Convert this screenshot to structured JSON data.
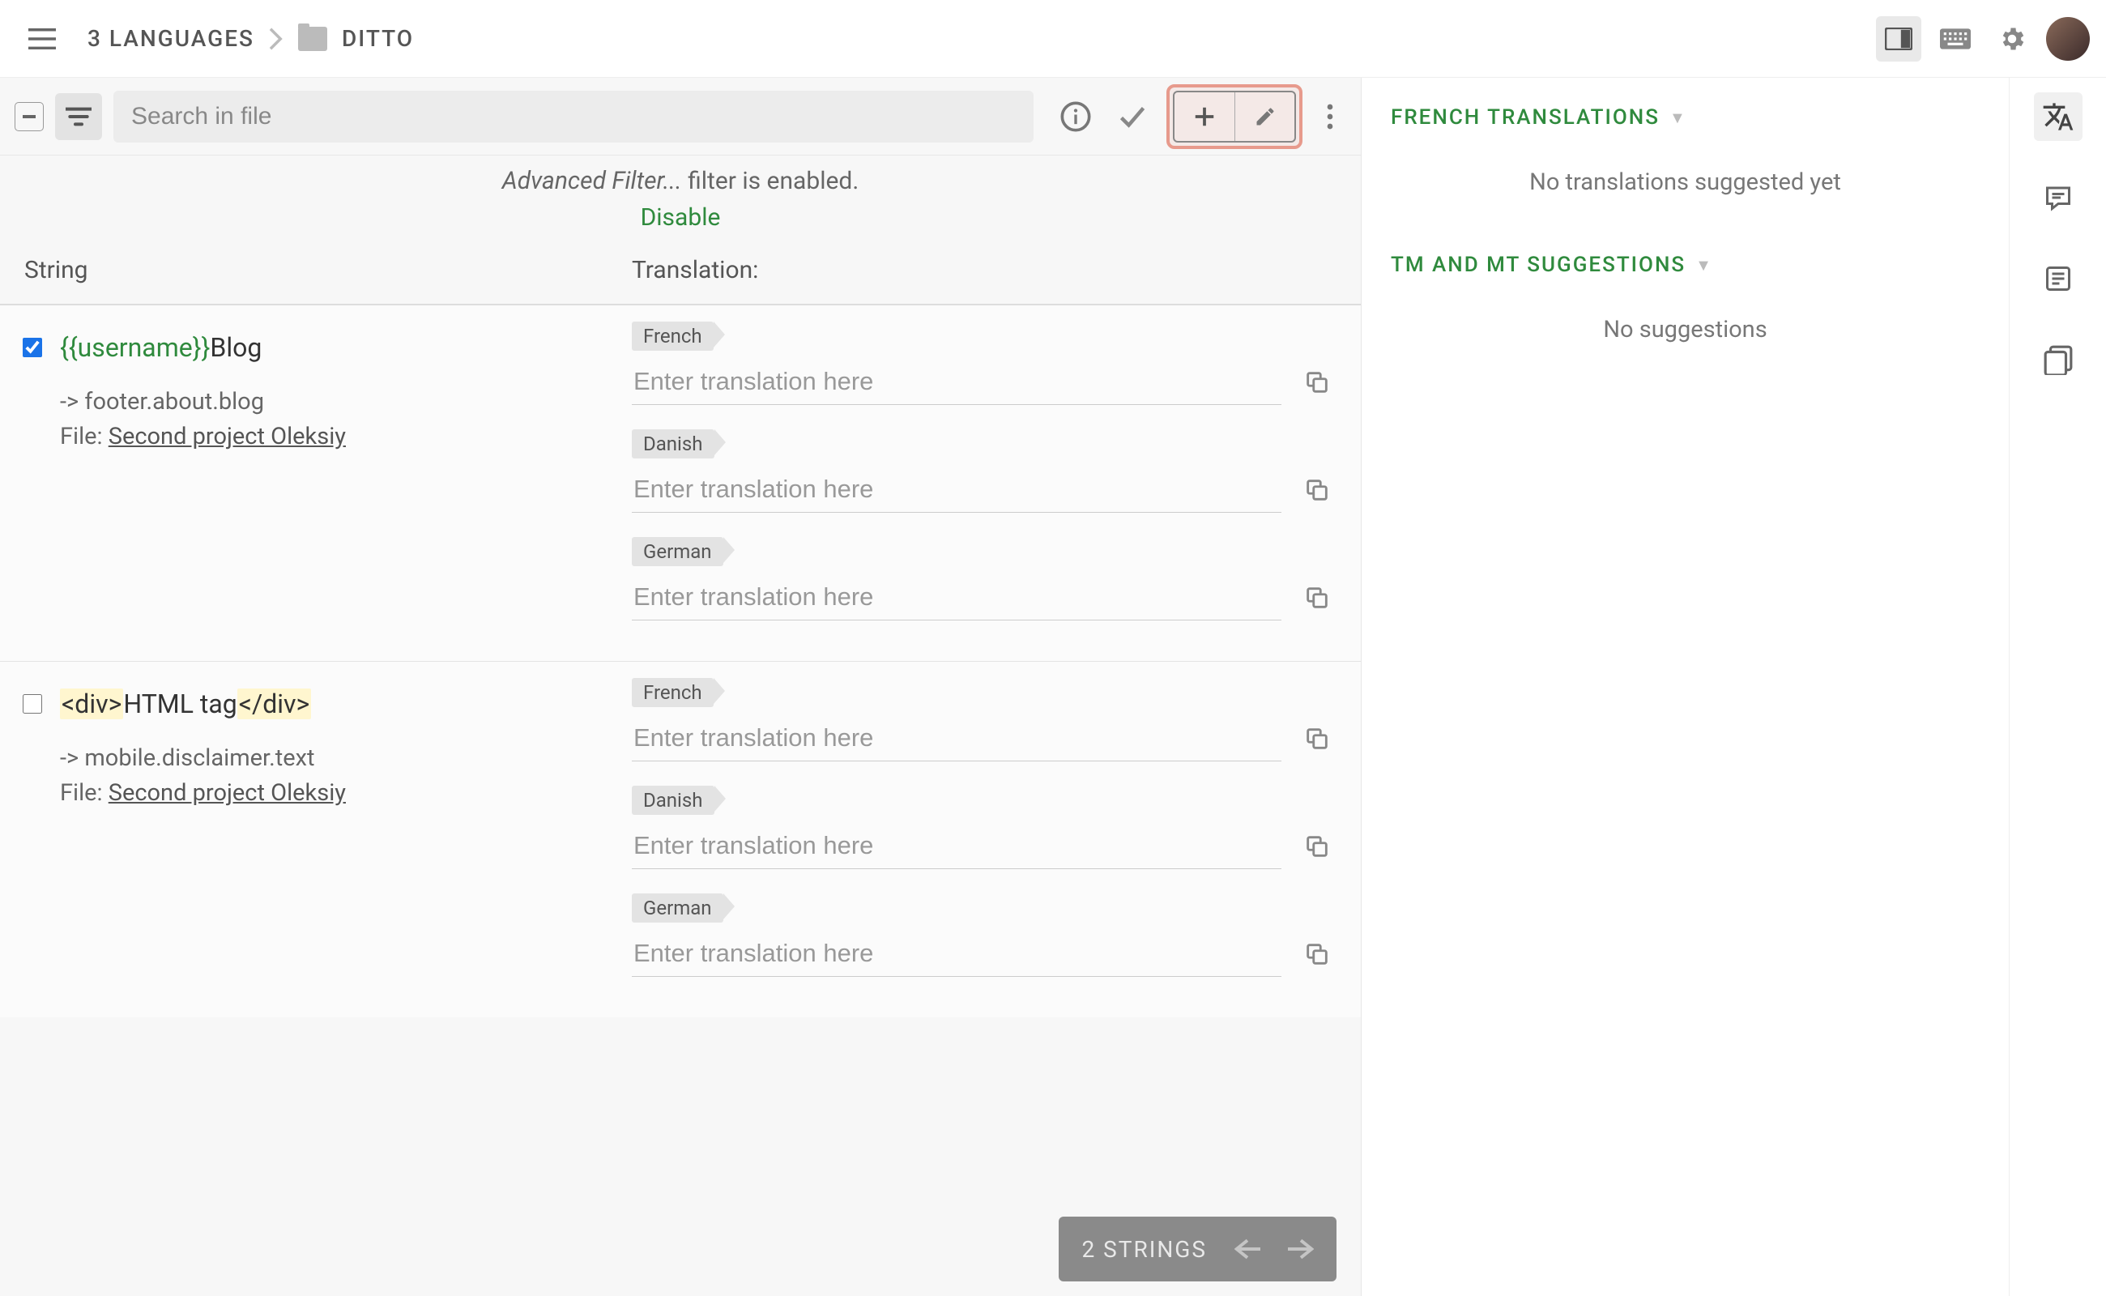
{
  "header": {
    "breadcrumb1": "3 LANGUAGES",
    "breadcrumb2": "DITTO"
  },
  "toolbar": {
    "search_placeholder": "Search in file"
  },
  "filter_notice": {
    "italic": "Advanced Filter...",
    "rest": " filter is enabled.",
    "disable": "Disable"
  },
  "columns": {
    "string": "String",
    "translation": "Translation:"
  },
  "strings": [
    {
      "checked": true,
      "token": "{{username}}",
      "rest": "Blog",
      "type": "token",
      "context": "-> footer.about.blog",
      "file_label": "File: ",
      "file_link": "Second project Oleksiy",
      "translations": [
        {
          "lang": "French",
          "placeholder": "Enter translation here"
        },
        {
          "lang": "Danish",
          "placeholder": "Enter translation here"
        },
        {
          "lang": "German",
          "placeholder": "Enter translation here"
        }
      ]
    },
    {
      "checked": false,
      "type": "html",
      "open_tag": "<div>",
      "rest": "HTML tag",
      "close_tag": "</div>",
      "context": "-> mobile.disclaimer.text",
      "file_label": "File: ",
      "file_link": "Second project Oleksiy",
      "translations": [
        {
          "lang": "French",
          "placeholder": "Enter translation here"
        },
        {
          "lang": "Danish",
          "placeholder": "Enter translation here"
        },
        {
          "lang": "German",
          "placeholder": "Enter translation here"
        }
      ]
    }
  ],
  "floater": {
    "count": "2 STRINGS"
  },
  "side": {
    "section1": "FRENCH TRANSLATIONS",
    "empty1": "No translations suggested yet",
    "section2": "TM AND MT SUGGESTIONS",
    "empty2": "No suggestions"
  }
}
